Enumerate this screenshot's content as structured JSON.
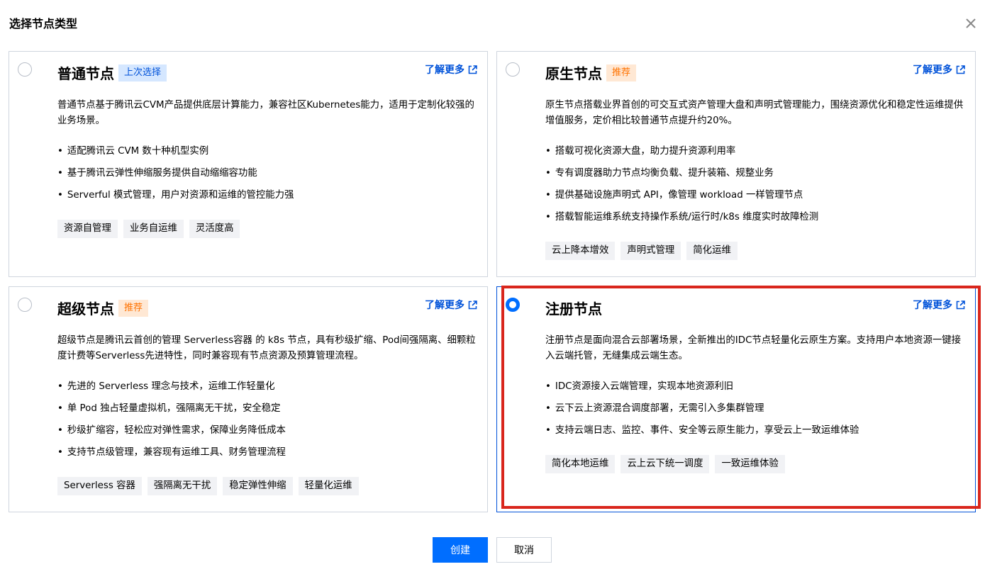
{
  "dialog": {
    "title": "选择节点类型",
    "close_icon": "close-icon"
  },
  "cards": [
    {
      "title": "普通节点",
      "badge": "上次选择",
      "badge_color": "#0052d9",
      "learn_more": "了解更多",
      "selected": false,
      "description": "普通节点基于腾讯云CVM产品提供底层计算能力，兼容社区Kubernetes能力，适用于定制化较强的业务场景。",
      "bullets": [
        "适配腾讯云 CVM 数十种机型实例",
        "基于腾讯云弹性伸缩服务提供自动缩缩容功能",
        "Serverful 模式管理，用户对资源和运维的管控能力强"
      ],
      "tags": [
        "资源自管理",
        "业务自运维",
        "灵活度高"
      ]
    },
    {
      "title": "原生节点",
      "badge": "推荐",
      "badge_color": "#ff7200",
      "learn_more": "了解更多",
      "selected": false,
      "description": "原生节点搭载业界首创的可交互式资产管理大盘和声明式管理能力，围绕资源优化和稳定性运维提供增值服务，定价相比较普通节点提升约20%。",
      "bullets": [
        "搭载可视化资源大盘，助力提升资源利用率",
        "专有调度器助力节点均衡负载、提升装箱、规整业务",
        "提供基础设施声明式 API，像管理 workload 一样管理节点",
        "搭载智能运维系统支持操作系统/运行时/k8s 维度实时故障检测"
      ],
      "tags": [
        "云上降本增效",
        "声明式管理",
        "简化运维"
      ]
    },
    {
      "title": "超级节点",
      "badge": "推荐",
      "badge_color": "#ff7200",
      "learn_more": "了解更多",
      "selected": false,
      "description": "超级节点是腾讯云首创的管理 Serverless容器 的 k8s 节点，具有秒级扩缩、Pod间强隔离、细颗粒度计费等Serverless先进特性，同时兼容现有节点资源及预算管理流程。",
      "bullets": [
        "先进的 Serverless 理念与技术，运维工作轻量化",
        "单 Pod 独占轻量虚拟机，强隔离无干扰，安全稳定",
        "秒级扩缩容，轻松应对弹性需求，保障业务降低成本",
        "支持节点级管理，兼容现有运维工具、财务管理流程"
      ],
      "tags": [
        "Serverless 容器",
        "强隔离无干扰",
        "稳定弹性伸缩",
        "轻量化运维"
      ]
    },
    {
      "title": "注册节点",
      "badge": "",
      "badge_color": "",
      "learn_more": "了解更多",
      "selected": true,
      "description": "注册节点是面向混合云部署场景，全新推出的IDC节点轻量化云原生方案。支持用户本地资源一键接入云端托管，无缝集成云端生态。",
      "bullets": [
        "IDC资源接入云端管理，实现本地资源利旧",
        "云下云上资源混合调度部署，无需引入多集群管理",
        "支持云端日志、监控、事件、安全等云原生能力，享受云上一致运维体验"
      ],
      "tags": [
        "简化本地运维",
        "云上云下统一调度",
        "一致运维体验"
      ]
    }
  ],
  "footer": {
    "create_label": "创建",
    "cancel_label": "取消"
  },
  "colors": {
    "primary": "#006eff",
    "link": "#0052d9",
    "highlight": "#d9261c",
    "border": "#cfd5de"
  }
}
